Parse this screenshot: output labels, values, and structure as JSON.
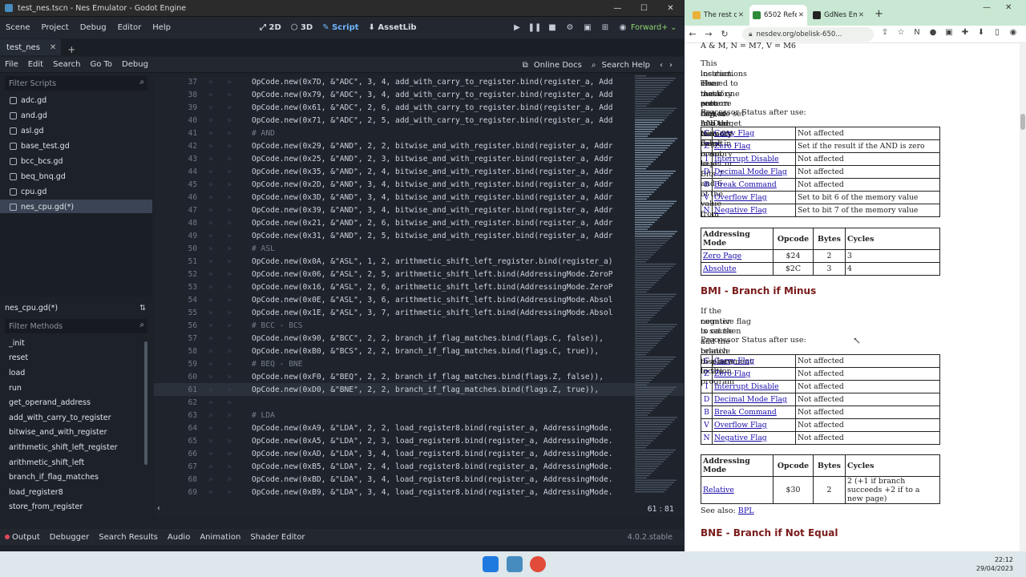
{
  "godot": {
    "window_title": "test_nes.tscn - Nes Emulator - Godot Engine",
    "menu": [
      "Scene",
      "Project",
      "Debug",
      "Editor",
      "Help"
    ],
    "workspaces": [
      "2D",
      "3D",
      "Script",
      "AssetLib"
    ],
    "renderer": "Forward+",
    "scene_tab": "test_nes",
    "script_menu": [
      "File",
      "Edit",
      "Search",
      "Go To",
      "Debug"
    ],
    "online_docs": "Online Docs",
    "search_help": "Search Help",
    "filter_scripts_placeholder": "Filter Scripts",
    "files": [
      "adc.gd",
      "and.gd",
      "asl.gd",
      "base_test.gd",
      "bcc_bcs.gd",
      "beq_bnq.gd",
      "cpu.gd",
      "nes_cpu.gd(*)"
    ],
    "selected_file_index": 7,
    "current_script": "nes_cpu.gd(*)",
    "filter_methods_placeholder": "Filter Methods",
    "methods": [
      "_init",
      "reset",
      "load",
      "run",
      "get_operand_address",
      "add_with_carry_to_register",
      "bitwise_and_with_register",
      "arithmetic_shift_left_register",
      "arithmetic_shift_left",
      "branch_if_flag_matches",
      "load_register8",
      "store_from_register"
    ],
    "code": [
      {
        "n": "37",
        "t": "OpCode.new(0x7D, &\"ADC\", 3, 4, add_with_carry_to_register.bind(register_a, Add"
      },
      {
        "n": "38",
        "t": "OpCode.new(0x79, &\"ADC\", 3, 4, add_with_carry_to_register.bind(register_a, Add"
      },
      {
        "n": "39",
        "t": "OpCode.new(0x61, &\"ADC\", 2, 6, add_with_carry_to_register.bind(register_a, Add"
      },
      {
        "n": "40",
        "t": "OpCode.new(0x71, &\"ADC\", 2, 5, add_with_carry_to_register.bind(register_a, Add"
      },
      {
        "n": "41",
        "t": "# AND"
      },
      {
        "n": "42",
        "t": "OpCode.new(0x29, &\"AND\", 2, 2, bitwise_and_with_register.bind(register_a, Addr"
      },
      {
        "n": "43",
        "t": "OpCode.new(0x25, &\"AND\", 2, 3, bitwise_and_with_register.bind(register_a, Addr"
      },
      {
        "n": "44",
        "t": "OpCode.new(0x35, &\"AND\", 2, 4, bitwise_and_with_register.bind(register_a, Addr"
      },
      {
        "n": "45",
        "t": "OpCode.new(0x2D, &\"AND\", 3, 4, bitwise_and_with_register.bind(register_a, Addr"
      },
      {
        "n": "46",
        "t": "OpCode.new(0x3D, &\"AND\", 3, 4, bitwise_and_with_register.bind(register_a, Addr"
      },
      {
        "n": "47",
        "t": "OpCode.new(0x39, &\"AND\", 3, 4, bitwise_and_with_register.bind(register_a, Addr"
      },
      {
        "n": "48",
        "t": "OpCode.new(0x21, &\"AND\", 2, 6, bitwise_and_with_register.bind(register_a, Addr"
      },
      {
        "n": "49",
        "t": "OpCode.new(0x31, &\"AND\", 2, 5, bitwise_and_with_register.bind(register_a, Addr"
      },
      {
        "n": "50",
        "t": "# ASL"
      },
      {
        "n": "51",
        "t": "OpCode.new(0x0A, &\"ASL\", 1, 2, arithmetic_shift_left_register.bind(register_a)"
      },
      {
        "n": "52",
        "t": "OpCode.new(0x06, &\"ASL\", 2, 5, arithmetic_shift_left.bind(AddressingMode.ZeroP"
      },
      {
        "n": "53",
        "t": "OpCode.new(0x16, &\"ASL\", 2, 6, arithmetic_shift_left.bind(AddressingMode.ZeroP"
      },
      {
        "n": "54",
        "t": "OpCode.new(0x0E, &\"ASL\", 3, 6, arithmetic_shift_left.bind(AddressingMode.Absol"
      },
      {
        "n": "55",
        "t": "OpCode.new(0x1E, &\"ASL\", 3, 7, arithmetic_shift_left.bind(AddressingMode.Absol"
      },
      {
        "n": "56",
        "t": "# BCC - BCS"
      },
      {
        "n": "57",
        "t": "OpCode.new(0x90, &\"BCC\", 2, 2, branch_if_flag_matches.bind(flags.C, false)),"
      },
      {
        "n": "58",
        "t": "OpCode.new(0xB0, &\"BCS\", 2, 2, branch_if_flag_matches.bind(flags.C, true)),"
      },
      {
        "n": "59",
        "t": "# BEQ - BNE"
      },
      {
        "n": "60",
        "t": "OpCode.new(0xF0, &\"BEQ\", 2, 2, branch_if_flag_matches.bind(flags.Z, false)),"
      },
      {
        "n": "61",
        "t": "OpCode.new(0xD0, &\"BNE\", 2, 2, branch_if_flag_matches.bind(flags.Z, true)),"
      },
      {
        "n": "62",
        "t": ""
      },
      {
        "n": "63",
        "t": "# LDA"
      },
      {
        "n": "64",
        "t": "OpCode.new(0xA9, &\"LDA\", 2, 2, load_register8.bind(register_a, AddressingMode."
      },
      {
        "n": "65",
        "t": "OpCode.new(0xA5, &\"LDA\", 2, 3, load_register8.bind(register_a, AddressingMode."
      },
      {
        "n": "66",
        "t": "OpCode.new(0xAD, &\"LDA\", 3, 4, load_register8.bind(register_a, AddressingMode."
      },
      {
        "n": "67",
        "t": "OpCode.new(0xB5, &\"LDA\", 2, 4, load_register8.bind(register_a, AddressingMode."
      },
      {
        "n": "68",
        "t": "OpCode.new(0xBD, &\"LDA\", 3, 4, load_register8.bind(register_a, AddressingMode."
      },
      {
        "n": "69",
        "t": "OpCode.new(0xB9, &\"LDA\", 3, 4, load_register8.bind(register_a, AddressingMode."
      }
    ],
    "current_line": "61",
    "cursor_pos": "61 :  81",
    "bottom_tabs": [
      "Output",
      "Debugger",
      "Search Results",
      "Audio",
      "Animation",
      "Shader Editor"
    ],
    "version": "4.0.2.stable"
  },
  "browser": {
    "tabs": [
      {
        "label": "The rest o",
        "color": "#e8b23a"
      },
      {
        "label": "6502 Refe",
        "color": "#2e8b3a"
      },
      {
        "label": "GdNes Em",
        "color": "#222222"
      }
    ],
    "active_tab_index": 1,
    "url": "nesdev.org/obelisk-650...",
    "page": {
      "top_formula": "A & M, N = M7, V = M6",
      "bit_desc": [
        "This instructions is used to test if one or more bits are set in a target memory",
        "location. The mask pattern in A is ANDed with the value in memory to set or",
        "clear the zero flag, but the result is not kept. Bits 7 and 6 of the value from",
        "memory are copied into the N and V flags."
      ],
      "status_label_1": "Processor Status after use:",
      "bit_status": [
        {
          "k": "C",
          "n": "Carry Flag",
          "v": "Not affected"
        },
        {
          "k": "Z",
          "n": "Zero Flag",
          "v": "Set if the result if the AND is zero"
        },
        {
          "k": "I",
          "n": "Interrupt Disable",
          "v": "Not affected"
        },
        {
          "k": "D",
          "n": "Decimal Mode Flag",
          "v": "Not affected"
        },
        {
          "k": "B",
          "n": "Break Command",
          "v": "Not affected"
        },
        {
          "k": "V",
          "n": "Overflow Flag",
          "v": "Set to bit 6 of the memory value"
        },
        {
          "k": "N",
          "n": "Negative Flag",
          "v": "Set to bit 7 of the memory value"
        }
      ],
      "am_headers": [
        "Addressing Mode",
        "Opcode",
        "Bytes",
        "Cycles"
      ],
      "bit_modes": [
        {
          "m": "Zero Page",
          "o": "$24",
          "b": "2",
          "c": "3"
        },
        {
          "m": "Absolute",
          "o": "$2C",
          "b": "3",
          "c": "4"
        }
      ],
      "bmi_title": "BMI - Branch if Minus",
      "bmi_desc": [
        "If the negative flag is set then add the relative displacement to the program",
        "counter to cause a branch to a new location."
      ],
      "status_label_2": "Processor Status after use:",
      "bmi_status": [
        {
          "k": "C",
          "n": "Carry Flag",
          "v": "Not affected"
        },
        {
          "k": "Z",
          "n": "Zero Flag",
          "v": "Not affected"
        },
        {
          "k": "I",
          "n": "Interrupt Disable",
          "v": "Not affected"
        },
        {
          "k": "D",
          "n": "Decimal Mode Flag",
          "v": "Not affected"
        },
        {
          "k": "B",
          "n": "Break Command",
          "v": "Not affected"
        },
        {
          "k": "V",
          "n": "Overflow Flag",
          "v": "Not affected"
        },
        {
          "k": "N",
          "n": "Negative Flag",
          "v": "Not affected"
        }
      ],
      "bmi_modes": [
        {
          "m": "Relative",
          "o": "$30",
          "b": "2",
          "c": "2 (+1 if branch succeeds +2 if to a new page)"
        }
      ],
      "see_also": "See also:",
      "see_also_link": "BPL",
      "bne_title": "BNE - Branch if Not Equal"
    }
  },
  "taskbar": {
    "time": "22:12",
    "date": "29/04/2023"
  }
}
